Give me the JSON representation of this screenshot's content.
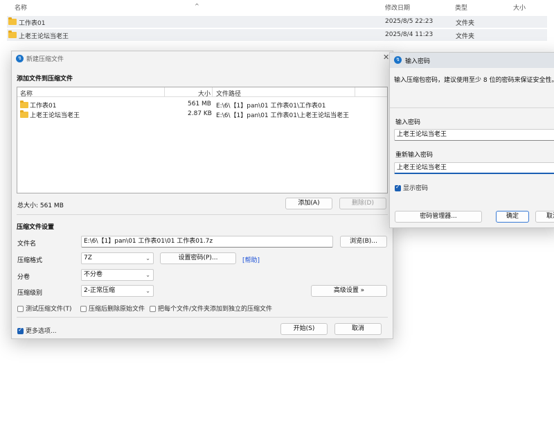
{
  "explorer": {
    "headers": {
      "name": "名称",
      "modified": "修改日期",
      "type": "类型",
      "size": "大小"
    },
    "rows": [
      {
        "name": "工作表01",
        "modified": "2025/8/5 22:23",
        "type": "文件夹"
      },
      {
        "name": "上老王论坛当老王",
        "modified": "2025/8/4 11:23",
        "type": "文件夹"
      }
    ]
  },
  "new_archive": {
    "title": "新建压缩文件",
    "add_section": "添加文件到压缩文件",
    "columns": {
      "name": "名称",
      "size": "大小",
      "path": "文件路径"
    },
    "files": [
      {
        "name": "工作表01",
        "size": "561 MB",
        "path": "E:\\6\\【1】pan\\01 工作表01\\工作表01"
      },
      {
        "name": "上老王论坛当老王",
        "size": "2.87 KB",
        "path": "E:\\6\\【1】pan\\01 工作表01\\上老王论坛当老王"
      }
    ],
    "total_size": "总大小: 561 MB",
    "add_button": "添加(A)",
    "delete_button": "删除(D)",
    "settings_section": "压缩文件设置",
    "filename_label": "文件名",
    "filename_value": "E:\\6\\【1】pan\\01 工作表01\\01 工作表01.7z",
    "browse_button": "浏览(B)...",
    "format_label": "压缩格式",
    "format_value": "7Z",
    "set_password_button": "设置密码(P)...",
    "help_link": "[帮助]",
    "split_label": "分卷",
    "split_value": "不分卷",
    "level_label": "压缩级别",
    "level_value": "2-正常压缩",
    "advanced_button": "高级设置 »",
    "test_checkbox": "测试压缩文件(T)",
    "delete_source_checkbox": "压缩后删除原始文件",
    "separate_checkbox": "把每个文件/文件夹添加到独立的压缩文件",
    "more_options_checkbox": "更多选项...",
    "start_button": "开始(S)",
    "cancel_button": "取消"
  },
  "password_dialog": {
    "title": "输入密码",
    "description": "输入压缩包密码，建议使用至少 8 位的密码来保证安全性。",
    "password_label": "输入密码",
    "password_value": "上老王论坛当老王",
    "confirm_label": "重新输入密码",
    "confirm_value": "上老王论坛当老王",
    "show_password_checkbox": "显示密码",
    "manager_button": "密码管理器...",
    "ok_button": "确定",
    "cancel_button": "取消"
  }
}
